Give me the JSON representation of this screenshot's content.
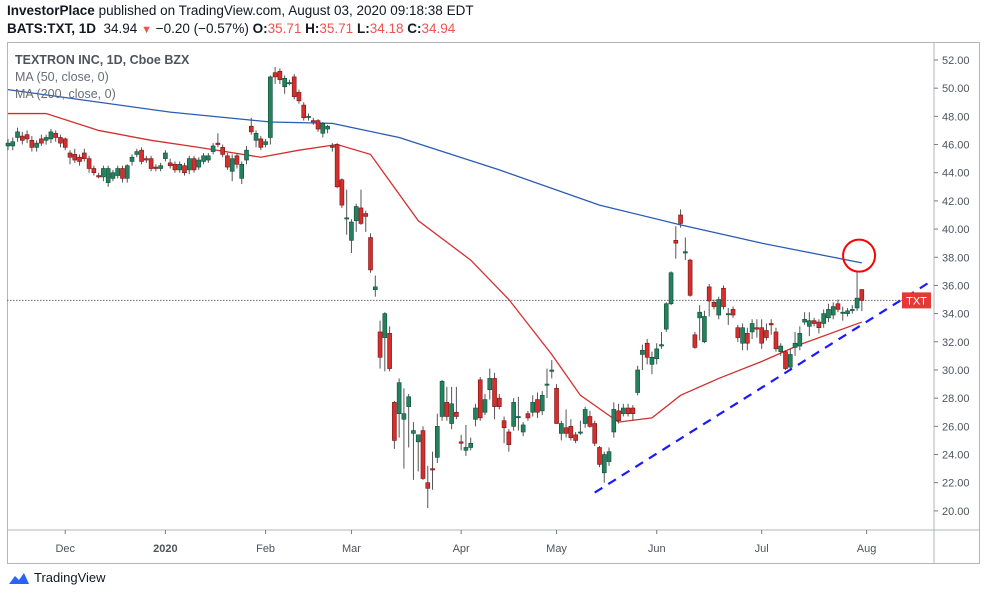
{
  "header": {
    "publisher": "InvestorPlace",
    "published_text": "published on TradingView.com, August 03, 2020 09:18:38 EDT",
    "symbol": "BATS:TXT, 1D",
    "last": "34.94",
    "change_icon": "triangle-down-icon",
    "change": "−0.20 (−0.57%)",
    "o_label": "O:",
    "o": "35.71",
    "h_label": "H:",
    "h": "35.71",
    "l_label": "L:",
    "l": "34.18",
    "c_label": "C:",
    "c": "34.94"
  },
  "legend": {
    "title": "TEXTRON INC, 1D, Cboe BZX",
    "ma50": "MA (50, close, 0)",
    "ma200": "MA (200, close, 0)"
  },
  "footer": {
    "brand": "TradingView",
    "logo_icon": "tradingview-logo-icon"
  },
  "colors": {
    "up": "#26805e",
    "down": "#d32f2f",
    "ma50": "#d32f2f",
    "ma200": "#2a5bb5",
    "trendline": "#1a1aff",
    "highlight_circle": "#ff0000",
    "price_label_bg": "#e53935"
  },
  "chart_data": {
    "type": "candlestick",
    "price_label": "TXT",
    "last_price": 34.94,
    "ylim": [
      19,
      53
    ],
    "y_ticks": [
      "52.00",
      "50.00",
      "48.00",
      "46.00",
      "44.00",
      "42.00",
      "40.00",
      "38.00",
      "36.00",
      "34.00",
      "32.00",
      "30.00",
      "28.00",
      "26.00",
      "24.00",
      "22.00",
      "20.00"
    ],
    "x_ticks": [
      {
        "label": "Dec",
        "bar": 12
      },
      {
        "label": "2020",
        "bar": 33,
        "bold": true
      },
      {
        "label": "Feb",
        "bar": 54
      },
      {
        "label": "Mar",
        "bar": 72
      },
      {
        "label": "Apr",
        "bar": 95
      },
      {
        "label": "May",
        "bar": 115
      },
      {
        "label": "Jun",
        "bar": 136
      },
      {
        "label": "Jul",
        "bar": 158
      },
      {
        "label": "Aug",
        "bar": 180
      }
    ],
    "candles_ohlc": [
      [
        45.9,
        46.4,
        45.6,
        46.1
      ],
      [
        45.9,
        46.5,
        45.6,
        46.2
      ],
      [
        46.5,
        47.2,
        46.2,
        46.9
      ],
      [
        46.6,
        46.9,
        46.0,
        46.3
      ],
      [
        46.7,
        47.0,
        46.1,
        46.4
      ],
      [
        46.3,
        46.6,
        45.5,
        45.8
      ],
      [
        45.8,
        46.3,
        45.5,
        46.1
      ],
      [
        46.4,
        46.7,
        45.9,
        46.1
      ],
      [
        46.3,
        46.7,
        46.0,
        46.5
      ],
      [
        46.4,
        47.1,
        46.1,
        46.9
      ],
      [
        46.8,
        47.0,
        46.2,
        46.5
      ],
      [
        46.5,
        46.7,
        45.8,
        46.1
      ],
      [
        46.4,
        46.5,
        45.6,
        45.8
      ],
      [
        45.4,
        45.6,
        44.6,
        45.1
      ],
      [
        45.3,
        45.7,
        44.7,
        44.9
      ],
      [
        45.1,
        45.3,
        44.5,
        44.8
      ],
      [
        45.4,
        45.7,
        44.8,
        45.0
      ],
      [
        45.0,
        45.2,
        44.0,
        44.3
      ],
      [
        44.3,
        44.5,
        43.8,
        44.0
      ],
      [
        43.8,
        44.0,
        43.6,
        43.7
      ],
      [
        43.7,
        44.5,
        43.4,
        44.3
      ],
      [
        43.3,
        44.5,
        43.0,
        44.3
      ],
      [
        43.6,
        44.2,
        43.4,
        44.0
      ],
      [
        43.8,
        44.5,
        43.6,
        44.3
      ],
      [
        44.3,
        44.5,
        43.3,
        43.6
      ],
      [
        43.6,
        44.6,
        43.3,
        44.5
      ],
      [
        44.8,
        45.3,
        44.5,
        45.1
      ],
      [
        45.3,
        45.7,
        45.1,
        45.5
      ],
      [
        45.6,
        45.8,
        44.6,
        44.8
      ],
      [
        45.0,
        45.2,
        44.7,
        44.9
      ],
      [
        45.0,
        45.2,
        44.1,
        44.3
      ],
      [
        44.4,
        44.6,
        44.1,
        44.3
      ],
      [
        44.3,
        44.7,
        44.1,
        44.5
      ],
      [
        45.0,
        45.6,
        44.8,
        45.4
      ],
      [
        44.7,
        45.0,
        44.3,
        44.5
      ],
      [
        44.6,
        44.8,
        44.0,
        44.2
      ],
      [
        44.2,
        44.8,
        44.0,
        44.6
      ],
      [
        44.5,
        44.7,
        43.8,
        44.0
      ],
      [
        44.2,
        45.2,
        43.9,
        45.0
      ],
      [
        45.0,
        45.2,
        44.0,
        44.2
      ],
      [
        44.4,
        45.1,
        44.2,
        44.9
      ],
      [
        44.8,
        45.4,
        44.6,
        45.2
      ],
      [
        44.9,
        45.4,
        44.7,
        45.2
      ],
      [
        45.5,
        46.1,
        45.3,
        45.9
      ],
      [
        46.1,
        46.8,
        45.8,
        46.0
      ],
      [
        45.8,
        46.0,
        45.1,
        45.3
      ],
      [
        45.2,
        45.4,
        44.2,
        44.4
      ],
      [
        44.1,
        45.3,
        43.4,
        45.0
      ],
      [
        45.2,
        45.4,
        44.3,
        44.6
      ],
      [
        43.6,
        44.8,
        43.2,
        44.6
      ],
      [
        44.9,
        45.9,
        44.6,
        45.6
      ],
      [
        47.3,
        47.9,
        46.7,
        46.9
      ],
      [
        46.3,
        47.0,
        45.8,
        46.8
      ],
      [
        46.4,
        46.6,
        45.6,
        45.8
      ],
      [
        46.0,
        46.4,
        45.8,
        46.2
      ],
      [
        46.5,
        50.9,
        46.0,
        50.8
      ],
      [
        51.1,
        51.5,
        50.3,
        50.8
      ],
      [
        51.2,
        51.4,
        50.3,
        50.6
      ],
      [
        50.1,
        50.9,
        49.6,
        50.7
      ],
      [
        50.4,
        50.6,
        50.2,
        50.4
      ],
      [
        50.8,
        51.0,
        49.2,
        49.4
      ],
      [
        49.7,
        49.9,
        48.9,
        49.1
      ],
      [
        48.8,
        49.0,
        47.7,
        47.9
      ],
      [
        48.0,
        48.2,
        47.7,
        48.0
      ],
      [
        47.7,
        47.9,
        47.4,
        47.6
      ],
      [
        47.7,
        47.8,
        46.9,
        47.1
      ],
      [
        46.8,
        47.6,
        46.5,
        47.5
      ],
      [
        47.1,
        47.4,
        46.8,
        47.3
      ],
      [
        45.9,
        46.1,
        45.5,
        45.8
      ],
      [
        46.0,
        46.1,
        42.9,
        43.0
      ],
      [
        43.5,
        43.6,
        41.5,
        41.7
      ],
      [
        40.8,
        42.8,
        39.6,
        40.8
      ],
      [
        39.2,
        40.7,
        38.3,
        40.5
      ],
      [
        40.6,
        41.8,
        39.8,
        41.6
      ],
      [
        41.5,
        42.8,
        40.3,
        40.4
      ],
      [
        41.1,
        41.3,
        39.8,
        40.9
      ],
      [
        39.4,
        39.7,
        36.9,
        37.1
      ],
      [
        35.7,
        36.7,
        35.2,
        35.9
      ],
      [
        32.7,
        33.5,
        30.1,
        30.9
      ],
      [
        32.3,
        34.1,
        29.9,
        34.0
      ],
      [
        32.6,
        33.1,
        29.9,
        30.1
      ],
      [
        27.7,
        27.8,
        24.4,
        25.0
      ],
      [
        26.9,
        29.4,
        25.2,
        29.1
      ],
      [
        26.5,
        28.7,
        23.0,
        26.9
      ],
      [
        27.4,
        28.3,
        24.5,
        28.1
      ],
      [
        25.5,
        26.3,
        22.2,
        25.7
      ],
      [
        24.9,
        25.4,
        22.8,
        25.4
      ],
      [
        25.7,
        26.0,
        22.2,
        22.3
      ],
      [
        22.0,
        23.2,
        20.2,
        21.6
      ],
      [
        23.0,
        24.2,
        21.5,
        22.9
      ],
      [
        23.8,
        26.9,
        23.4,
        26.0
      ],
      [
        26.7,
        29.3,
        26.4,
        29.2
      ],
      [
        27.7,
        28.8,
        26.4,
        26.7
      ],
      [
        26.2,
        28.8,
        25.8,
        27.6
      ],
      [
        27.0,
        28.8,
        26.5,
        26.7
      ],
      [
        24.9,
        25.4,
        24.3,
        24.8
      ],
      [
        24.3,
        26.1,
        23.9,
        24.5
      ],
      [
        24.5,
        25.2,
        24.3,
        24.8
      ],
      [
        26.5,
        27.6,
        26.0,
        27.3
      ],
      [
        29.3,
        29.5,
        26.4,
        26.6
      ],
      [
        27.0,
        28.3,
        26.8,
        27.9
      ],
      [
        28.6,
        30.1,
        27.9,
        29.4
      ],
      [
        29.4,
        29.8,
        26.5,
        27.4
      ],
      [
        28.0,
        28.3,
        27.2,
        27.4
      ],
      [
        26.4,
        26.7,
        24.8,
        25.9
      ],
      [
        25.6,
        25.8,
        24.2,
        24.7
      ],
      [
        26.0,
        28.0,
        25.7,
        27.7
      ],
      [
        26.7,
        28.1,
        25.7,
        26.7
      ],
      [
        25.6,
        26.3,
        25.3,
        26.1
      ],
      [
        26.9,
        27.1,
        26.4,
        26.6
      ],
      [
        27.0,
        28.2,
        26.7,
        27.7
      ],
      [
        27.9,
        28.4,
        26.6,
        27.0
      ],
      [
        27.1,
        28.5,
        26.8,
        28.2
      ],
      [
        29.0,
        30.1,
        28.0,
        29.0
      ],
      [
        29.9,
        30.7,
        29.4,
        30.0
      ],
      [
        28.7,
        29.0,
        26.2,
        26.2
      ],
      [
        25.5,
        26.4,
        25.0,
        26.2
      ],
      [
        25.9,
        27.2,
        25.2,
        25.5
      ],
      [
        26.0,
        26.5,
        25.0,
        25.2
      ],
      [
        25.4,
        25.6,
        24.8,
        25.0
      ],
      [
        25.6,
        26.4,
        25.4,
        25.6
      ],
      [
        26.2,
        27.4,
        25.9,
        27.2
      ],
      [
        26.7,
        27.1,
        25.9,
        26.0
      ],
      [
        26.2,
        26.4,
        24.6,
        24.8
      ],
      [
        24.5,
        24.6,
        23.1,
        23.3
      ],
      [
        22.7,
        24.2,
        22.0,
        24.0
      ],
      [
        23.5,
        24.5,
        23.2,
        24.2
      ],
      [
        25.6,
        27.7,
        25.2,
        27.2
      ],
      [
        27.1,
        27.6,
        26.2,
        26.4
      ],
      [
        26.9,
        27.6,
        26.7,
        27.3
      ],
      [
        27.3,
        27.6,
        26.7,
        26.9
      ],
      [
        27.3,
        27.5,
        26.4,
        26.9
      ],
      [
        28.4,
        30.3,
        28.2,
        30.0
      ],
      [
        31.1,
        31.8,
        30.0,
        31.4
      ],
      [
        31.9,
        32.2,
        30.4,
        30.9
      ],
      [
        30.4,
        31.3,
        29.7,
        30.9
      ],
      [
        30.8,
        31.9,
        30.4,
        31.5
      ],
      [
        31.7,
        32.7,
        31.5,
        31.8
      ],
      [
        32.9,
        34.8,
        32.7,
        34.7
      ],
      [
        34.7,
        37.0,
        34.6,
        36.9
      ],
      [
        39.2,
        40.2,
        37.9,
        39.0
      ],
      [
        41.0,
        41.4,
        40.1,
        40.4
      ],
      [
        38.3,
        39.4,
        37.8,
        38.4
      ],
      [
        37.8,
        37.9,
        35.2,
        35.3
      ],
      [
        32.5,
        32.7,
        31.5,
        31.6
      ],
      [
        33.7,
        34.6,
        32.1,
        34.1
      ],
      [
        32.0,
        34.2,
        31.9,
        33.8
      ],
      [
        35.9,
        36.1,
        33.8,
        34.9
      ],
      [
        34.8,
        35.0,
        34.3,
        34.5
      ],
      [
        33.9,
        35.2,
        33.6,
        35.0
      ],
      [
        35.8,
        36.0,
        34.3,
        34.5
      ],
      [
        34.0,
        34.4,
        33.2,
        34.0
      ],
      [
        34.3,
        34.5,
        33.7,
        33.9
      ],
      [
        33.0,
        33.2,
        32.0,
        32.3
      ],
      [
        31.9,
        33.3,
        31.4,
        33.0
      ],
      [
        32.6,
        33.0,
        31.4,
        31.9
      ],
      [
        32.7,
        33.6,
        32.2,
        33.3
      ],
      [
        33.0,
        33.6,
        32.3,
        32.9
      ],
      [
        33.0,
        33.6,
        31.5,
        31.9
      ],
      [
        32.8,
        33.3,
        32.1,
        32.3
      ],
      [
        33.3,
        33.6,
        32.5,
        33.2
      ],
      [
        32.7,
        33.0,
        31.3,
        31.5
      ],
      [
        31.3,
        31.9,
        31.0,
        31.7
      ],
      [
        31.3,
        31.4,
        30.0,
        30.1
      ],
      [
        30.2,
        31.5,
        30.1,
        31.1
      ],
      [
        31.6,
        32.7,
        31.0,
        31.9
      ],
      [
        31.7,
        33.1,
        31.4,
        32.6
      ],
      [
        33.4,
        34.1,
        33.2,
        33.6
      ],
      [
        33.1,
        34.1,
        32.4,
        33.5
      ],
      [
        33.5,
        33.7,
        33.1,
        33.3
      ],
      [
        33.4,
        33.6,
        32.6,
        33.0
      ],
      [
        33.3,
        34.3,
        33.0,
        34.0
      ],
      [
        33.7,
        34.7,
        33.4,
        34.3
      ],
      [
        33.9,
        34.8,
        33.6,
        34.5
      ],
      [
        34.7,
        35.0,
        34.1,
        34.3
      ],
      [
        34.1,
        34.5,
        33.5,
        34.1
      ],
      [
        34.0,
        34.4,
        33.8,
        34.2
      ],
      [
        34.3,
        34.6,
        34.0,
        34.3
      ],
      [
        34.4,
        37.0,
        34.2,
        35.1
      ],
      [
        35.71,
        35.71,
        34.18,
        34.94
      ]
    ],
    "ma50_points": [
      [
        0,
        48.2
      ],
      [
        8,
        48.2
      ],
      [
        19,
        47.0
      ],
      [
        30,
        46.3
      ],
      [
        40,
        45.8
      ],
      [
        53,
        45.1
      ],
      [
        61,
        45.6
      ],
      [
        69,
        46.0
      ],
      [
        76,
        45.3
      ],
      [
        86,
        40.6
      ],
      [
        97,
        37.8
      ],
      [
        105,
        35.0
      ],
      [
        114,
        31.1
      ],
      [
        120,
        28.2
      ],
      [
        128,
        26.3
      ],
      [
        135,
        26.6
      ],
      [
        141,
        28.2
      ],
      [
        149,
        29.4
      ],
      [
        158,
        30.6
      ],
      [
        166,
        31.8
      ],
      [
        179,
        33.4
      ]
    ],
    "ma200_points": [
      [
        0,
        49.9
      ],
      [
        34,
        48.3
      ],
      [
        55,
        47.6
      ],
      [
        68,
        47.5
      ],
      [
        82,
        46.5
      ],
      [
        103,
        44.2
      ],
      [
        124,
        41.7
      ],
      [
        141,
        40.3
      ],
      [
        158,
        39.0
      ],
      [
        179,
        37.6
      ]
    ],
    "trendline": {
      "from": [
        123,
        21.3
      ],
      "to": [
        194,
        36.4
      ],
      "style": "dashed"
    },
    "highlight_circle": {
      "bar": 178,
      "price": 37.9
    }
  }
}
